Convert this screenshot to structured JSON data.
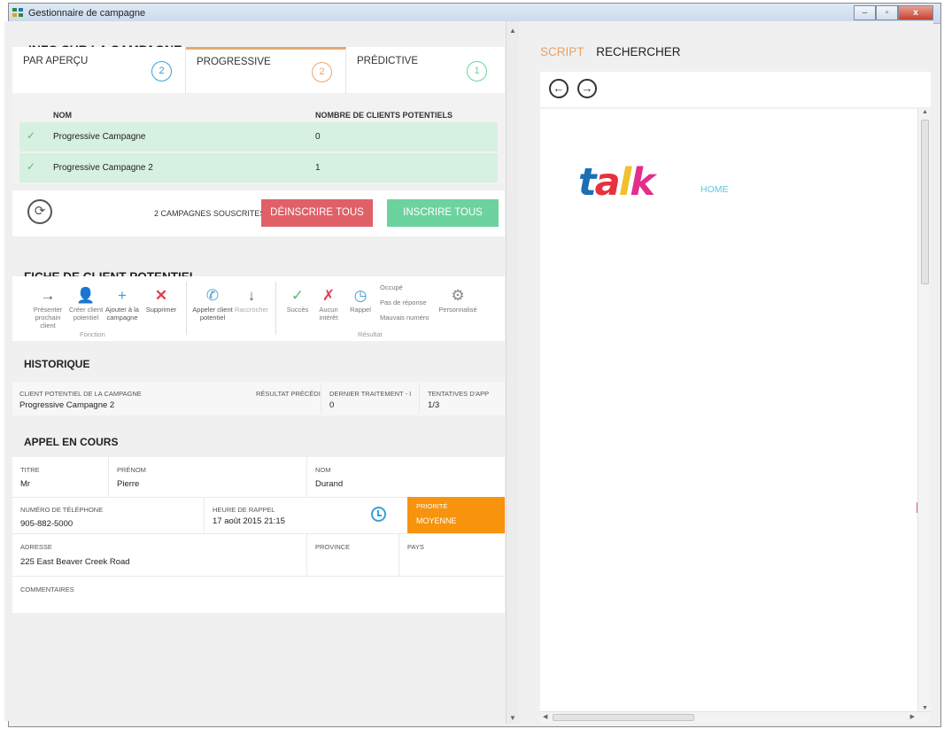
{
  "window": {
    "title": "Gestionnaire de campagne",
    "buttons": [
      "–",
      "▫",
      "x"
    ]
  },
  "campaign_info": {
    "title": "INFO SUR LA CAMPAGNE",
    "tabs": [
      {
        "label": "PAR APERÇU",
        "count": "2",
        "color": "#3aa0d8"
      },
      {
        "label": "PROGRESSIVE",
        "count": "2",
        "color": "#e8a871"
      },
      {
        "label": "PRÉDICTIVE",
        "count": "1",
        "color": "#6cd39e"
      }
    ],
    "table": {
      "headers": [
        "NOM",
        "NOMBRE DE CLIENTS POTENTIELS"
      ],
      "rows": [
        {
          "name": "Progressive Campagne",
          "count": "0"
        },
        {
          "name": "Progressive Campagne 2",
          "count": "1"
        }
      ]
    },
    "subscribed_text": "2 CAMPAGNES SOUSCRITES",
    "unsubscribe_all": "DÉINSCRIRE TOUS",
    "subscribe_all": "INSCRIRE TOUS"
  },
  "lead_card": {
    "title": "FICHE DE CLIENT POTENTIEL",
    "function_group": "Fonction",
    "result_group": "Résultat",
    "tools": {
      "present": [
        "Présenter",
        "prochain client"
      ],
      "create": [
        "Créer client",
        "potentiel"
      ],
      "add": [
        "Ajouter à la",
        "campagne"
      ],
      "delete": [
        "Supprimer"
      ],
      "call": [
        "Appeler client",
        "potentiel"
      ],
      "hangup": [
        "Raccrocher"
      ],
      "success": [
        "Succès"
      ],
      "no_interest": [
        "Aucun",
        "intérêt"
      ],
      "callback": [
        "Rappel"
      ],
      "custom": [
        "Personnalisé"
      ]
    },
    "result_options": [
      "Occupé",
      "Pas de réponse",
      "Mauvais numéro"
    ]
  },
  "history": {
    "title": "HISTORIQUE",
    "headers": [
      "CLIENT POTENTIEL DE LA CAMPAGNE",
      "RÉSULTAT PRÉCÉDI",
      "DERNIER TRAITEMENT - I",
      "TENTATIVES D'APP"
    ],
    "row": [
      "Progressive Campagne 2",
      "",
      "0",
      "1/3"
    ]
  },
  "current_call": {
    "title": "APPEL EN COURS",
    "title_label": "TITRE",
    "title_value": "Mr",
    "firstname_label": "PRÉNOM",
    "firstname_value": "Pierre",
    "lastname_label": "NOM",
    "lastname_value": "Durand",
    "phone_label": "NUMÉRO DE TÉLÉPHONE",
    "phone_value": "905-882-5000",
    "callback_label": "HEURE DE RAPPEL",
    "callback_value": "17 août 2015 21:15",
    "priority_label": "PRIORITÉ",
    "priority_value": "MOYENNE",
    "address_label": "ADRESSE",
    "address_value": "225 East Beaver Creek Road",
    "province_label": "PROVINCE",
    "country_label": "PAYS",
    "comments_label": "COMMENTAIRES"
  },
  "right_panel": {
    "tab_script": "SCRIPT",
    "tab_search": "RECHERCHER",
    "logo_letters": [
      "t",
      "a",
      "l",
      "k"
    ],
    "logo_colors": [
      "#1a6fb5",
      "#e8303f",
      "#f0c030",
      "#e32e8c"
    ],
    "home_link": "HOME"
  }
}
